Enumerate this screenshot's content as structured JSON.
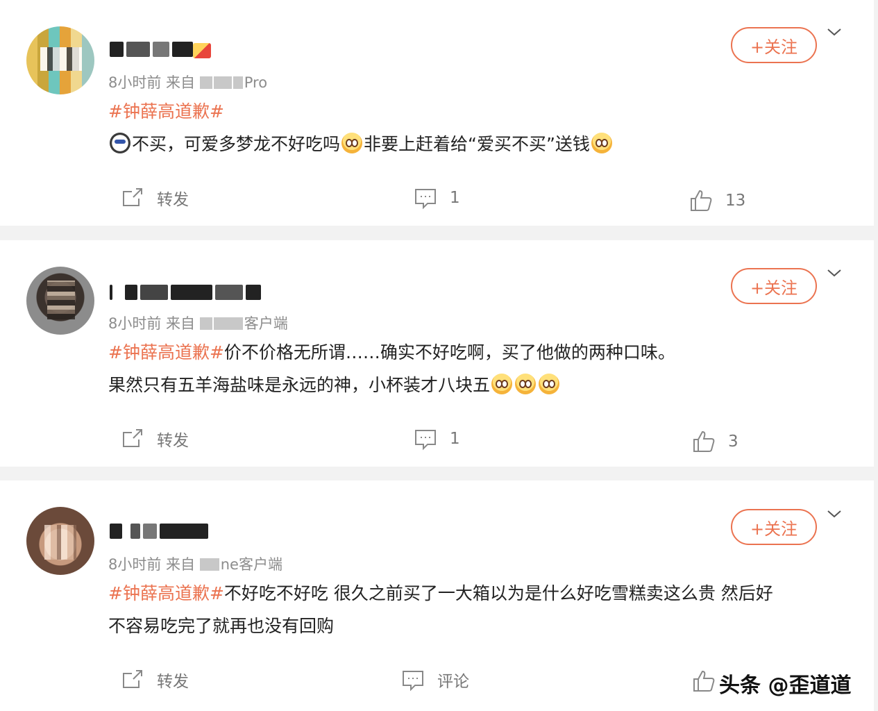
{
  "posts": [
    {
      "meta_prefix": "8小时前  来自",
      "meta_suffix": "Pro",
      "tag": "#钟薛高道歉#",
      "segments": [
        "不买，可爱多梦龙不好吃吗",
        "非要上赶着给“爱买不买”送钱"
      ],
      "follow_label": "+关注",
      "repost_label": "转发",
      "comment_count": "1",
      "like_count": "13"
    },
    {
      "meta_prefix": "8小时前  来自",
      "meta_suffix": "客户端",
      "tag": "#钟薛高道歉#",
      "line1": "价不价格无所谓……确实不好吃啊，买了他做的两种口味。",
      "line2": "果然只有五羊海盐味是永远的神，小杯装才八块五",
      "follow_label": "+关注",
      "repost_label": "转发",
      "comment_count": "1",
      "like_count": "3"
    },
    {
      "meta_prefix": "8小时前  来自",
      "meta_suffix": "ne客户端",
      "tag": "#钟薛高道歉#",
      "line1": "不好吃不好吃 很久之前买了一大箱以为是什么好吃雪糕卖这么贵 然后好",
      "line2": "不容易吃完了就再也没有回购",
      "follow_label": "+关注",
      "repost_label": "转发",
      "comment_label": "评论"
    }
  ],
  "watermark": "头条 @歪道道",
  "colors": {
    "accent": "#eb7350",
    "background": "#f2f2f2",
    "card": "#ffffff"
  }
}
